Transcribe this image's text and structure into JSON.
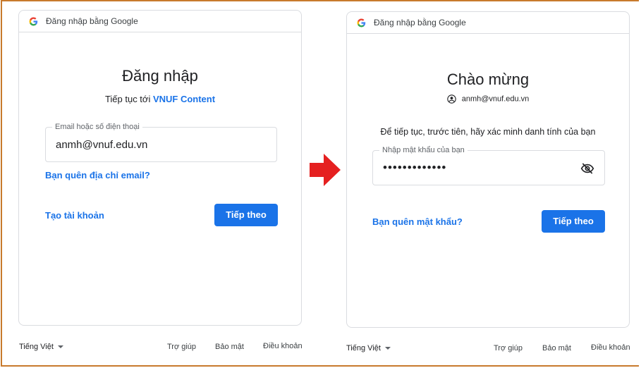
{
  "colors": {
    "accent": "#1a73e8",
    "frame": "#c87a2c",
    "arrow": "#e52020"
  },
  "left_panel": {
    "header_title": "Đăng nhập bằng Google",
    "title": "Đăng nhập",
    "subtitle_prefix": "Tiếp tục tới ",
    "subtitle_brand": "VNUF Content",
    "email_field": {
      "label": "Email hoặc số điện thoại",
      "value": "anmh@vnuf.edu.vn"
    },
    "forgot_email": "Bạn quên địa chỉ email?",
    "create_account": "Tạo tài khoản",
    "next_button": "Tiếp theo"
  },
  "right_panel": {
    "header_title": "Đăng nhập bằng Google",
    "title": "Chào mừng",
    "account": "anmh@vnuf.edu.vn",
    "verify_text": "Để tiếp tục, trước tiên, hãy xác minh danh tính của bạn",
    "password_field": {
      "label": "Nhập mật khẩu của bạn",
      "value": "•••••••••••••"
    },
    "visibility_icon": "eye-off-icon",
    "forgot_password": "Bạn quên mật khẩu?",
    "next_button": "Tiếp theo"
  },
  "left_footer": {
    "language": "Tiếng Việt",
    "help": "Trợ giúp",
    "privacy": "Bảo mật",
    "terms": "Điều khoản"
  },
  "right_footer": {
    "language": "Tiếng Việt",
    "help": "Trợ giúp",
    "privacy": "Bảo mật",
    "terms": "Điều khoản"
  }
}
